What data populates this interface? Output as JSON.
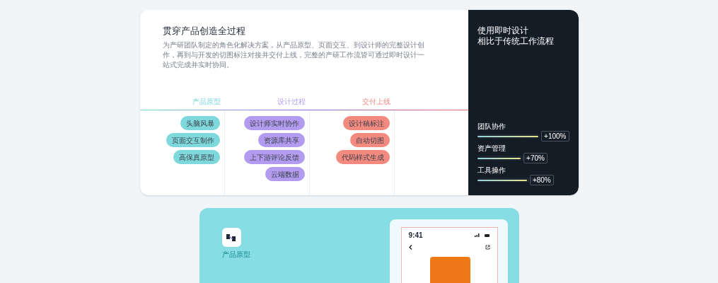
{
  "process_card": {
    "title": "贯穿产品创造全过程",
    "description": "为产研团队制定的角色化解决方案，从产品原型、页面交互、到设计师的完整设计创作，再到与开发的切图标注对接并交付上线，完整的产研工作流皆可通过即时设计一站式完成并实时协同。",
    "stages": [
      {
        "label": "产品原型",
        "color": "#7fd8dc",
        "tags": [
          "头脑风暴",
          "页面交互制作",
          "高保真原型"
        ]
      },
      {
        "label": "设计过程",
        "color": "#b39cf0",
        "tags": [
          "设计师实时协作",
          "资源库共享",
          "上下游评论反馈",
          "云端数据"
        ]
      },
      {
        "label": "交付上线",
        "color": "#f28a80",
        "tags": [
          "设计稿标注",
          "自动切图",
          "代码样式生成"
        ]
      }
    ]
  },
  "comparison": {
    "title_lines": [
      "使用即时设计",
      "相比于传统工作流程"
    ],
    "metrics": [
      {
        "label": "团队协作",
        "level": 1,
        "reading": "+100%"
      },
      {
        "label": "资产管理",
        "level": 0.7,
        "reading": "+70%"
      },
      {
        "label": "工具操作",
        "level": 0.8,
        "reading": "+80%"
      }
    ]
  },
  "feature_card": {
    "label": "产品原型",
    "phone": {
      "time": "9:41"
    }
  }
}
